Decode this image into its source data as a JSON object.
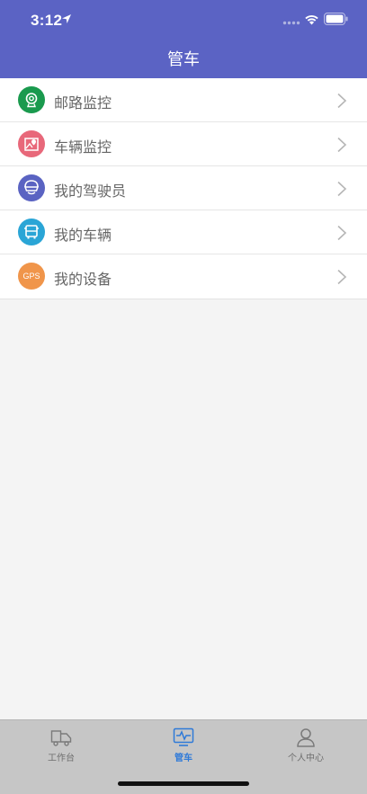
{
  "status_bar": {
    "time": "3:12"
  },
  "header": {
    "title": "管车"
  },
  "menu": {
    "items": [
      {
        "label": "邮路监控",
        "icon": "webcam-icon",
        "color": "#1a9a4e"
      },
      {
        "label": "车辆监控",
        "icon": "map-pin-icon",
        "color": "#e8687a"
      },
      {
        "label": "我的驾驶员",
        "icon": "driver-icon",
        "color": "#5a63c2"
      },
      {
        "label": "我的车辆",
        "icon": "bus-icon",
        "color": "#2aa5d6"
      },
      {
        "label": "我的设备",
        "icon": "gps-icon",
        "icon_text": "GPS",
        "color": "#f0954a"
      }
    ]
  },
  "tabbar": {
    "tabs": [
      {
        "label": "工作台",
        "icon": "truck-icon"
      },
      {
        "label": "管车",
        "icon": "monitor-pulse-icon",
        "active": true
      },
      {
        "label": "个人中心",
        "icon": "user-icon"
      }
    ]
  },
  "colors": {
    "header": "#5b63c4",
    "active_tab": "#2f7ad8"
  }
}
